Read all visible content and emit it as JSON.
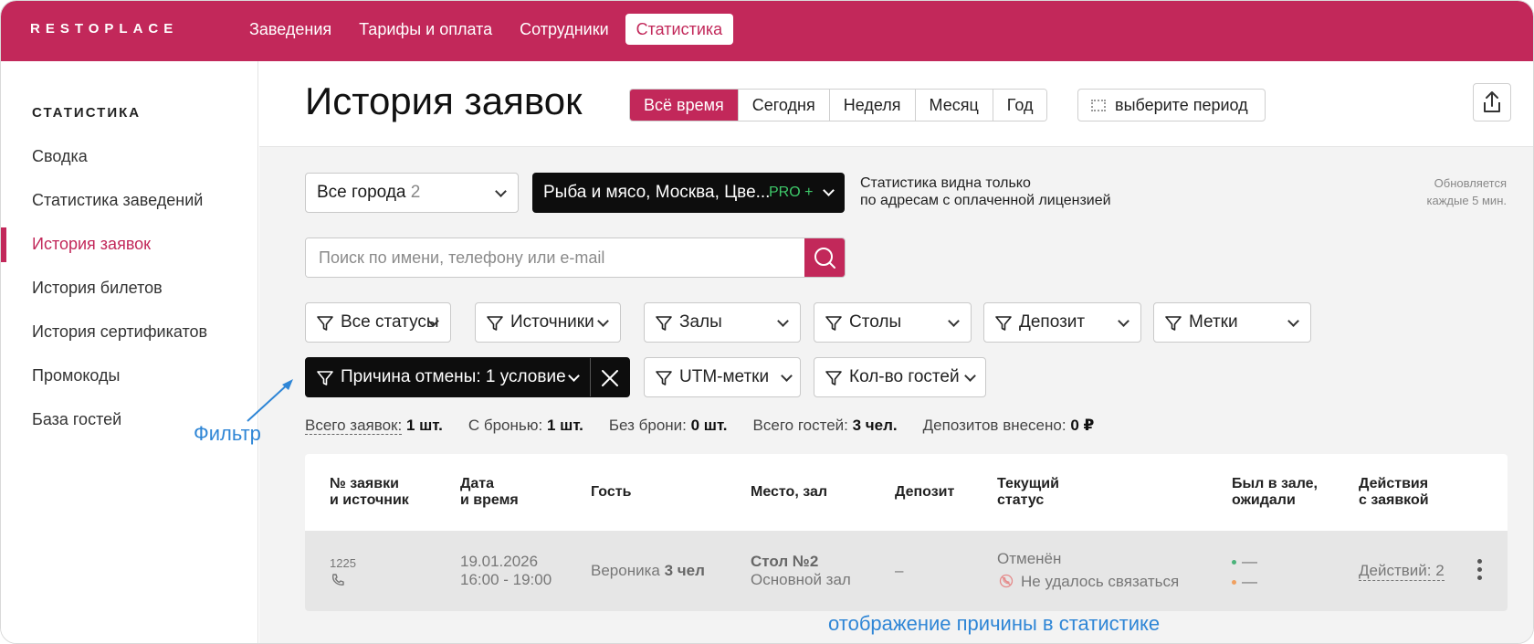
{
  "topbar": {
    "logo": "RESTOPLACE",
    "nav": [
      "Заведения",
      "Тарифы и оплата",
      "Сотрудники",
      "Статистика"
    ],
    "active_nav": "Статистика"
  },
  "sidebar": {
    "title": "СТАТИСТИКА",
    "items": [
      "Сводка",
      "Статистика заведений",
      "История заявок",
      "История билетов",
      "История сертификатов",
      "Промокоды",
      "База гостей"
    ],
    "active_item": "История заявок"
  },
  "header": {
    "title": "История заявок",
    "periods": [
      "Всё время",
      "Сегодня",
      "Неделя",
      "Месяц",
      "Год"
    ],
    "active_period": "Всё время",
    "range_label": "выберите период"
  },
  "toolbar": {
    "city_label": "Все города",
    "city_count": "2",
    "venue_label": "Рыба и мясо, Москва, Цве...",
    "venue_badge": "PRO +",
    "license_note_1": "Статистика видна только",
    "license_note_2": "по адресам с оплаченной лицензией",
    "refresh_note_1": "Обновляется",
    "refresh_note_2": "каждые 5 мин."
  },
  "search": {
    "placeholder": "Поиск по имени, телефону или e-mail"
  },
  "filters": {
    "statuses": "Все статусы",
    "sources": "Источники",
    "halls": "Залы",
    "tables": "Столы",
    "deposit": "Депозит",
    "tags": "Метки",
    "cancel_reason": "Причина отмены: 1 условие",
    "utm": "UTM-метки",
    "guests": "Кол-во гостей"
  },
  "summary": {
    "total_label": "Всего заявок:",
    "total_value": "1 шт.",
    "booked_label": "С бронью:",
    "booked_value": "1 шт.",
    "unbooked_label": "Без брони:",
    "unbooked_value": "0 шт.",
    "guests_label": "Всего гостей:",
    "guests_value": "3 чел.",
    "deposits_label": "Депозитов внесено:",
    "deposits_value": "0 ₽"
  },
  "table": {
    "headers": {
      "id_1": "№ заявки",
      "id_2": "и источник",
      "date_1": "Дата",
      "date_2": "и время",
      "guest": "Гость",
      "place": "Место, зал",
      "deposit": "Депозит",
      "status_1": "Текущий",
      "status_2": "статус",
      "visit_1": "Был в зале,",
      "visit_2": "ожидали",
      "actions_1": "Действия",
      "actions_2": "с заявкой"
    },
    "rows": [
      {
        "id": "1225",
        "date": "19.01.2026",
        "time": "16:00 - 19:00",
        "guest_name": "Вероника",
        "guest_count": "3 чел",
        "place_table": "Стол №2",
        "place_hall": "Основной зал",
        "deposit": "–",
        "status": "Отменён",
        "cancel_reason": "Не удалось связаться",
        "visited": "—",
        "waited": "—",
        "actions": "Действий: 2"
      }
    ]
  },
  "annotations": {
    "filter": "Фильтр",
    "reason": "отображение причины в статистике"
  },
  "colors": {
    "brand": "#c2285a",
    "annotation": "#2f86d6",
    "pro_badge": "#3ec96a"
  }
}
